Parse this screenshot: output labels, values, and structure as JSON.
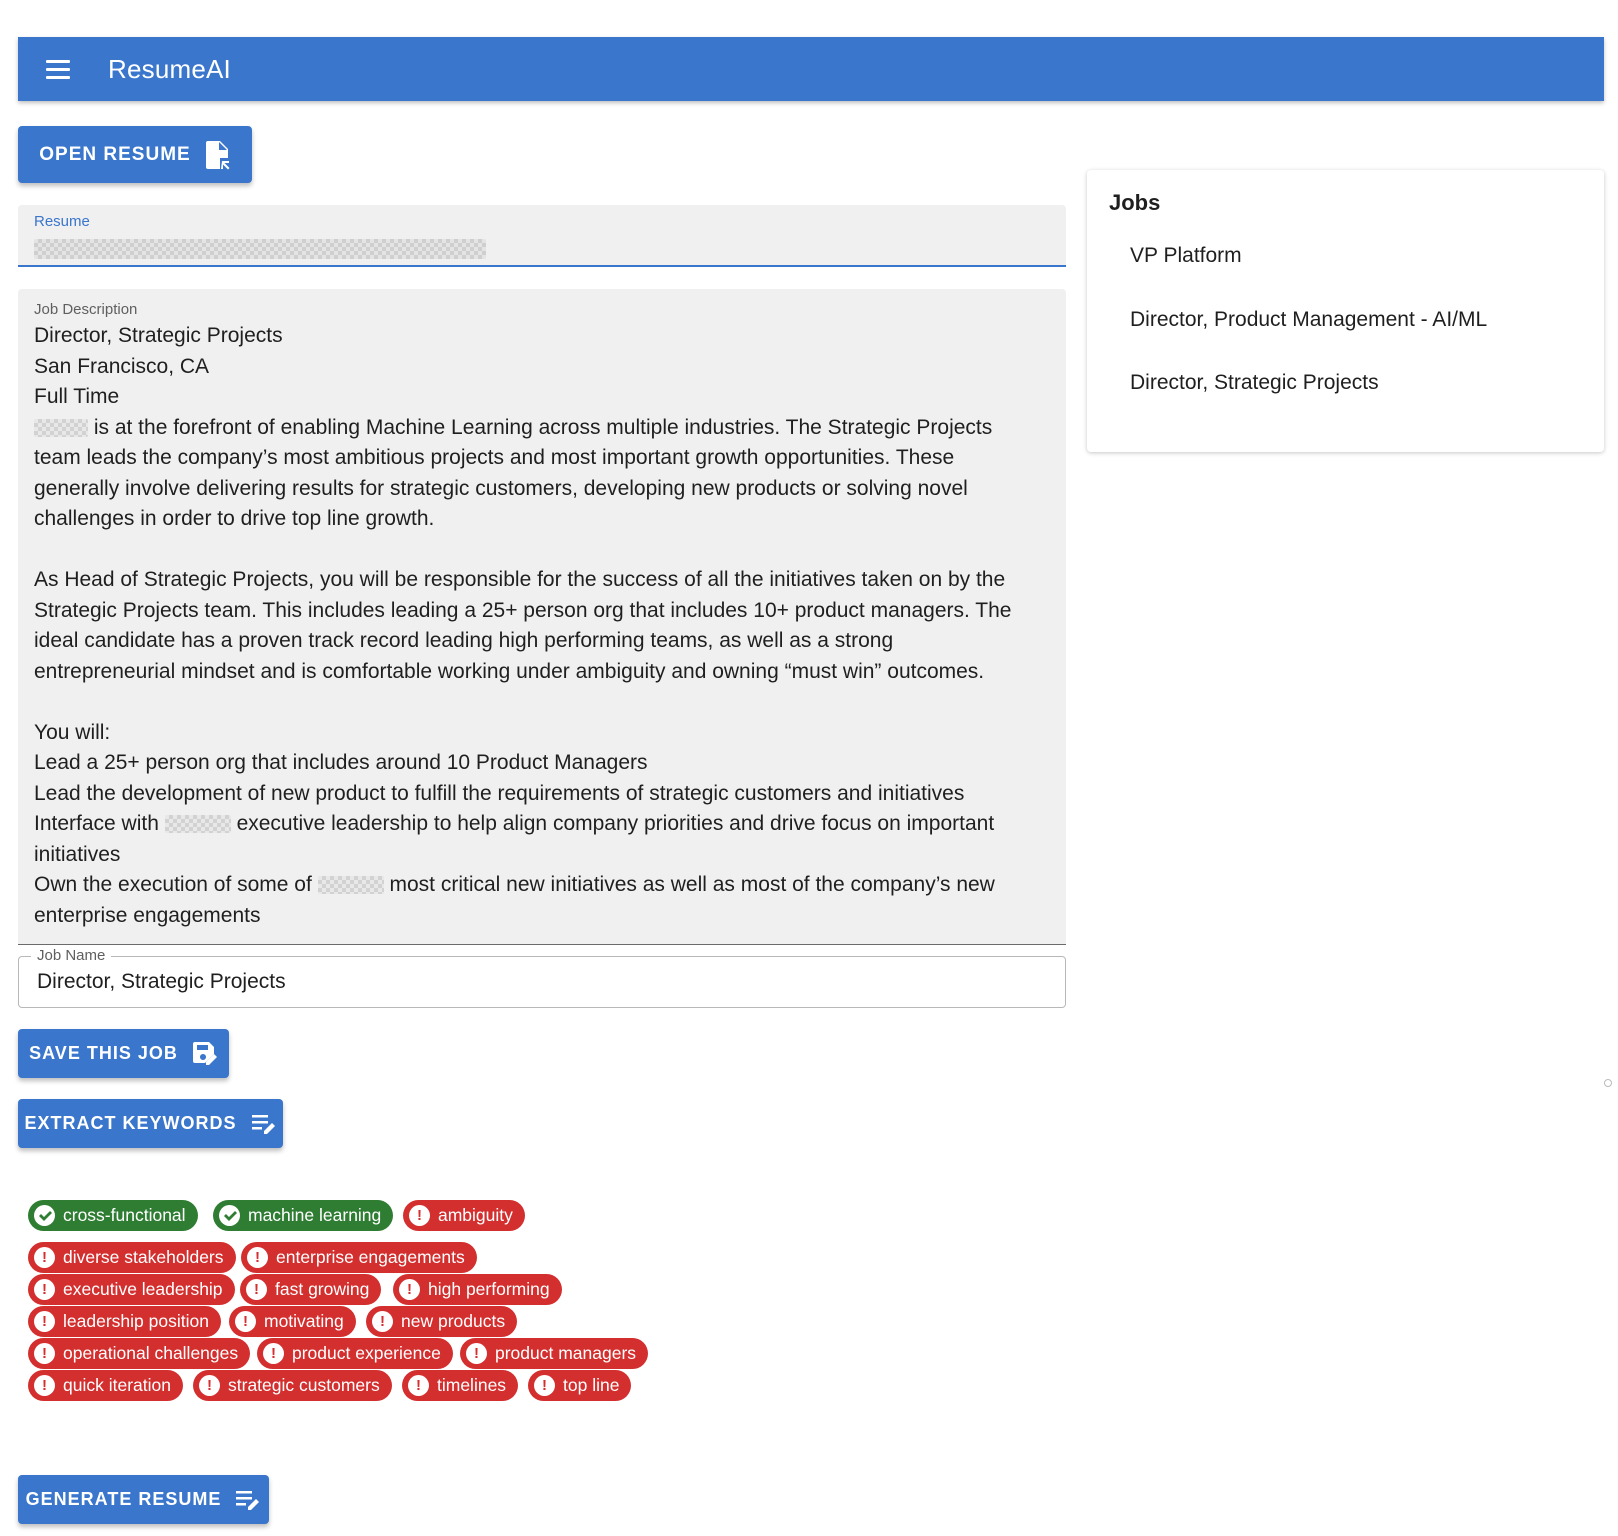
{
  "appbar": {
    "title": "ResumeAI"
  },
  "buttons": {
    "open_resume": "OPEN RESUME",
    "save_job": "SAVE THIS JOB",
    "extract_keywords": "EXTRACT KEYWORDS",
    "generate_resume": "GENERATE RESUME"
  },
  "resume_field": {
    "label": "Resume"
  },
  "job_description": {
    "label": "Job Description",
    "lines": [
      "Director, Strategic Projects",
      "San Francisco, CA",
      "Full Time",
      " is at the forefront of enabling Machine Learning across multiple industries. The Strategic Projects",
      "team leads the company’s most ambitious projects and most important growth opportunities. These",
      "generally involve delivering results for strategic customers, developing new products or solving novel",
      "challenges in order to drive top line growth.",
      "",
      "As Head of Strategic Projects, you will be responsible for the success of all the initiatives taken on by the",
      "Strategic Projects team. This includes leading a 25+ person org that includes 10+ product managers. The",
      "ideal candidate has a proven track record leading high performing teams, as well as a strong",
      "entrepreneurial mindset and is comfortable working under ambiguity and owning “must win” outcomes.",
      "",
      "You will:",
      "Lead a 25+ person org that includes around 10 Product Managers",
      "Lead the development of new product to fulfill the requirements of strategic customers and initiatives",
      "Interface with ",
      " executive leadership to help align company priorities and drive focus on important",
      "initiatives",
      "Own the execution of some of ",
      " most critical new initiatives as well as most of the company’s new",
      "enterprise engagements"
    ]
  },
  "job_name": {
    "label": "Job Name",
    "value": "Director, Strategic Projects"
  },
  "keywords": {
    "matched": [
      "cross-functional",
      "machine learning"
    ],
    "missing": [
      "ambiguity",
      "diverse stakeholders",
      "enterprise engagements",
      "executive leadership",
      "fast growing",
      "high performing",
      "leadership position",
      "motivating",
      "new products",
      "operational challenges",
      "product experience",
      "product managers",
      "quick iteration",
      "strategic customers",
      "timelines",
      "top line"
    ]
  },
  "jobs": {
    "title": "Jobs",
    "items": [
      "VP Platform",
      "Director, Product Management - AI/ML",
      "Director, Strategic Projects"
    ]
  },
  "colors": {
    "primary": "#3a76cc",
    "matched": "#2e7d32",
    "missing": "#d32f2f"
  },
  "icons": {
    "menu": "hamburger-menu-icon",
    "open_resume": "file-open-icon",
    "save_job": "save-edit-icon",
    "extract": "edit-note-icon",
    "generate": "edit-note-icon",
    "matched": "check-circle-icon",
    "missing": "error-icon"
  }
}
